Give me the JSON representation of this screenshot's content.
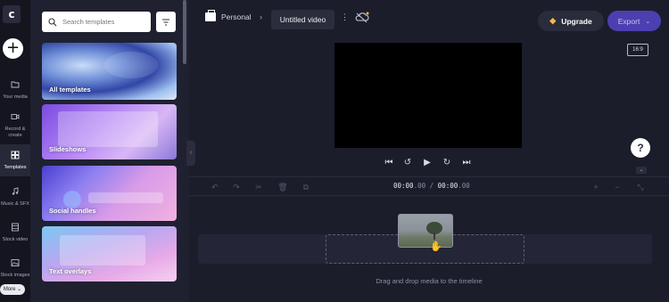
{
  "app": {
    "logo_letter": "c"
  },
  "rail": {
    "add_label": "+",
    "items": [
      {
        "label": "Your media",
        "icon": "folder-icon"
      },
      {
        "label": "Record & create",
        "icon": "camera-icon"
      },
      {
        "label": "Templates",
        "icon": "grid-icon"
      },
      {
        "label": "Music & SFX",
        "icon": "music-icon"
      },
      {
        "label": "Stock video",
        "icon": "film-icon"
      },
      {
        "label": "Stock images",
        "icon": "image-icon"
      }
    ],
    "more_label": "More ⌄"
  },
  "panel": {
    "search_placeholder": "Search templates",
    "cards": [
      {
        "title": "All templates"
      },
      {
        "title": "Slideshows"
      },
      {
        "title": "Social handles"
      },
      {
        "title": "Text overlays"
      }
    ]
  },
  "topbar": {
    "workspace": "Personal",
    "project_title": "Untitled video",
    "upgrade_label": "Upgrade",
    "export_label": "Export"
  },
  "preview": {
    "aspect_ratio": "16:9"
  },
  "timeline": {
    "time_current": "00:00",
    "time_current_frac": ".00",
    "time_sep": " / ",
    "time_total": "00:00",
    "time_total_frac": ".00",
    "drop_hint": "Drag and drop media to the timeline"
  },
  "colors": {
    "background": "#1b1d2b",
    "export": "#4c3fb0",
    "upgrade_gem": "#f2b84b"
  }
}
